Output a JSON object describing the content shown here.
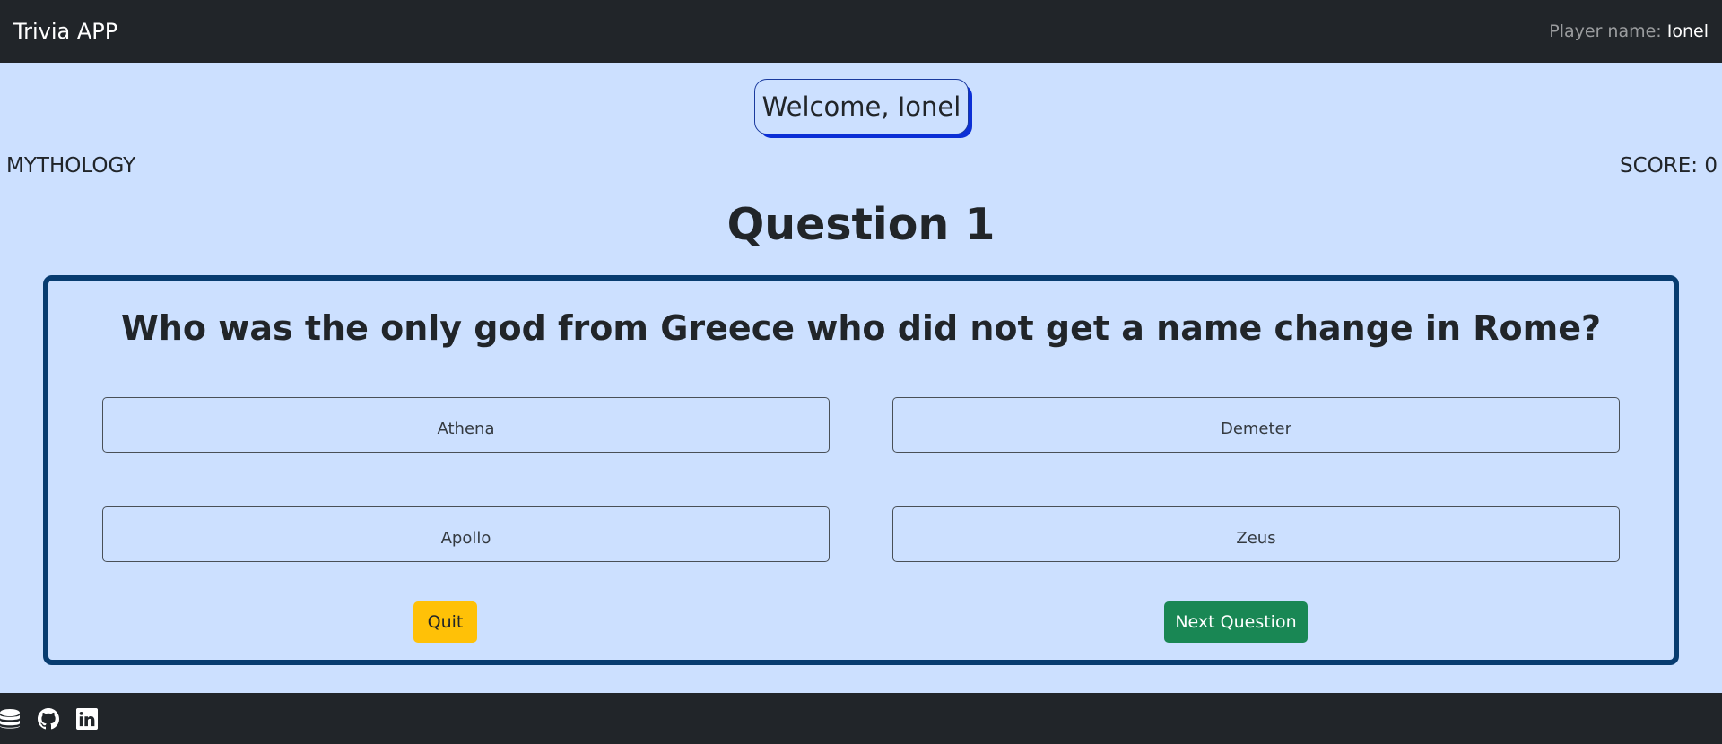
{
  "navbar": {
    "brand": "Trivia APP",
    "player_label": "Player name:",
    "player_name": "Ionel"
  },
  "welcome": "Welcome, Ionel",
  "category": "MYTHOLOGY",
  "score": "SCORE: 0",
  "question_number": "Question 1",
  "question": {
    "text": "Who was the only god from Greece who did not get a name change in Rome?",
    "answers": [
      "Athena",
      "Demeter",
      "Apollo",
      "Zeus"
    ]
  },
  "actions": {
    "quit": "Quit",
    "next": "Next Question"
  },
  "footer": {
    "icons": [
      "database-icon",
      "github-icon",
      "linkedin-icon"
    ]
  },
  "colors": {
    "background": "#cce0ff",
    "navbar": "#212529",
    "card_border": "#073c70",
    "welcome_shadow": "#0b2fd6",
    "quit": "#ffc107",
    "next": "#198754"
  }
}
